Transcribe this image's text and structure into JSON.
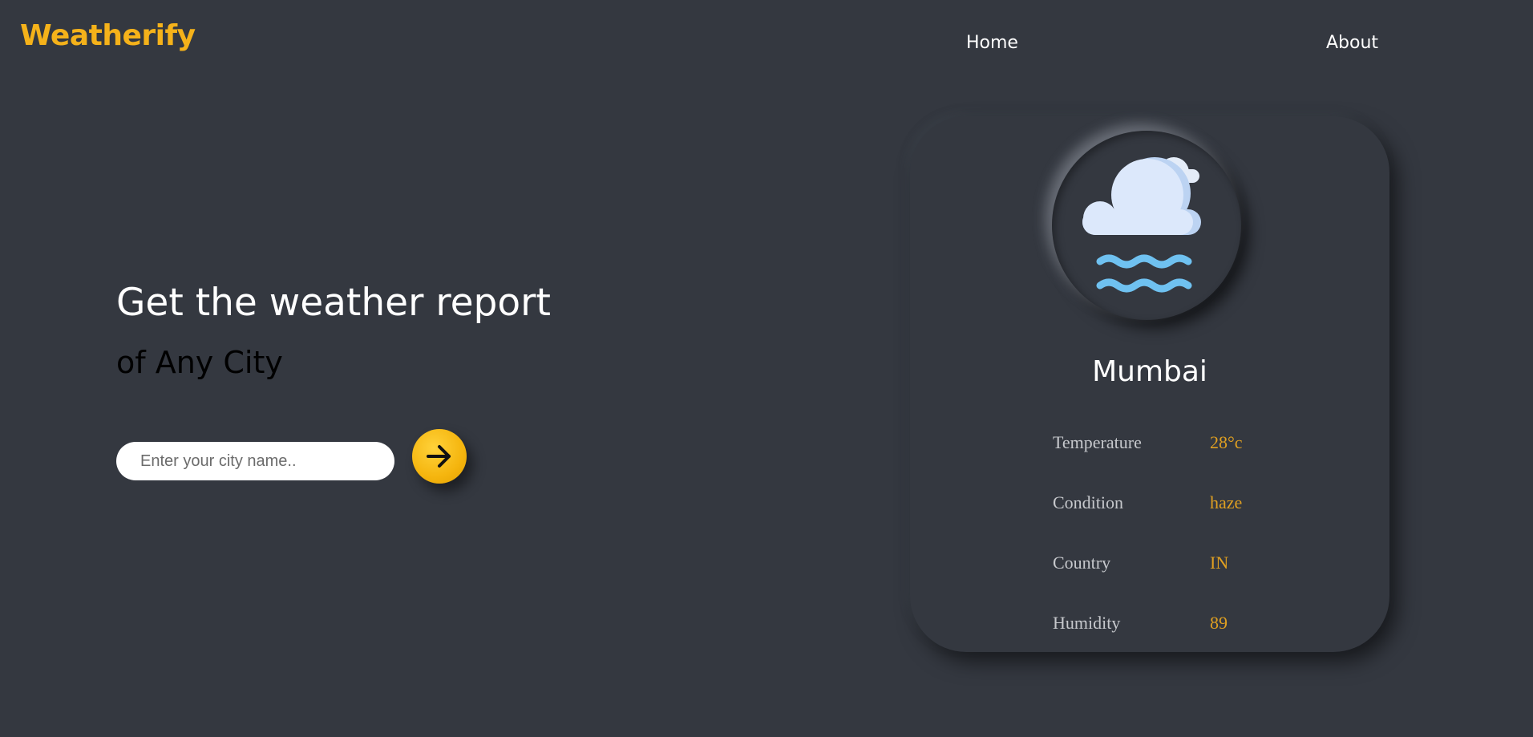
{
  "header": {
    "brand": "Weatherify",
    "nav": [
      {
        "label": "Home"
      },
      {
        "label": "About"
      }
    ]
  },
  "hero": {
    "title": "Get the weather report",
    "subtitle": "of Any City",
    "search": {
      "placeholder": "Enter your city name..",
      "value": ""
    },
    "submit_icon": "arrow-right-icon"
  },
  "weather_card": {
    "icon": "haze-cloud-icon",
    "city": "Mumbai",
    "details": [
      {
        "label": "Temperature",
        "value": "28°c"
      },
      {
        "label": "Condition",
        "value": "haze"
      },
      {
        "label": "Country",
        "value": "IN"
      },
      {
        "label": "Humidity",
        "value": "89"
      }
    ]
  },
  "colors": {
    "background": "#343840",
    "accent": "#f5b21a",
    "value_text": "#e0a021"
  }
}
